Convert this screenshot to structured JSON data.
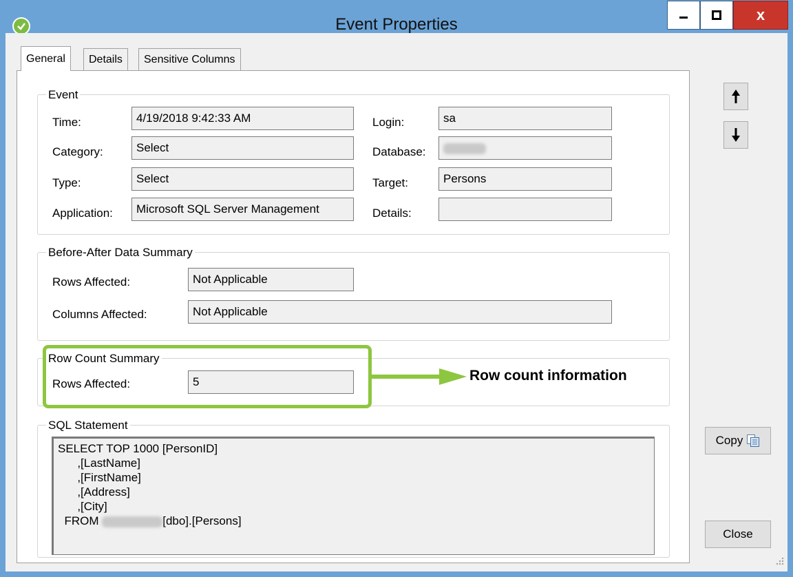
{
  "window": {
    "title": "Event Properties",
    "close_glyph": "x"
  },
  "tabs": [
    "General",
    "Details",
    "Sensitive Columns"
  ],
  "event": {
    "legend": "Event",
    "time_label": "Time:",
    "time_value": "4/19/2018 9:42:33 AM",
    "category_label": "Category:",
    "category_value": "Select",
    "type_label": "Type:",
    "type_value": "Select",
    "application_label": "Application:",
    "application_value": "Microsoft SQL Server Management",
    "login_label": "Login:",
    "login_value": "sa",
    "database_label": "Database:",
    "target_label": "Target:",
    "target_value": "Persons",
    "details_label": "Details:",
    "details_value": ""
  },
  "before_after": {
    "legend": "Before-After Data Summary",
    "rows_label": "Rows Affected:",
    "rows_value": "Not Applicable",
    "columns_label": "Columns Affected:",
    "columns_value": "Not Applicable"
  },
  "row_count": {
    "legend": "Row Count Summary",
    "rows_label": "Rows Affected:",
    "rows_value": "5"
  },
  "annotation": {
    "text": "Row count information",
    "color": "#8dc63f"
  },
  "sql": {
    "legend": "SQL Statement",
    "line1": "SELECT TOP 1000 [PersonID]",
    "line2": "      ,[LastName]",
    "line3": "      ,[FirstName]",
    "line4": "      ,[Address]",
    "line5": "      ,[City]",
    "line6_prefix": "  FROM ",
    "line6_suffix": "[dbo].[Persons]"
  },
  "buttons": {
    "copy": "Copy",
    "close": "Close"
  },
  "colors": {
    "title_bar": "#6ba3d6",
    "close_button": "#c8362b",
    "app_icon": "#7dbb42"
  }
}
